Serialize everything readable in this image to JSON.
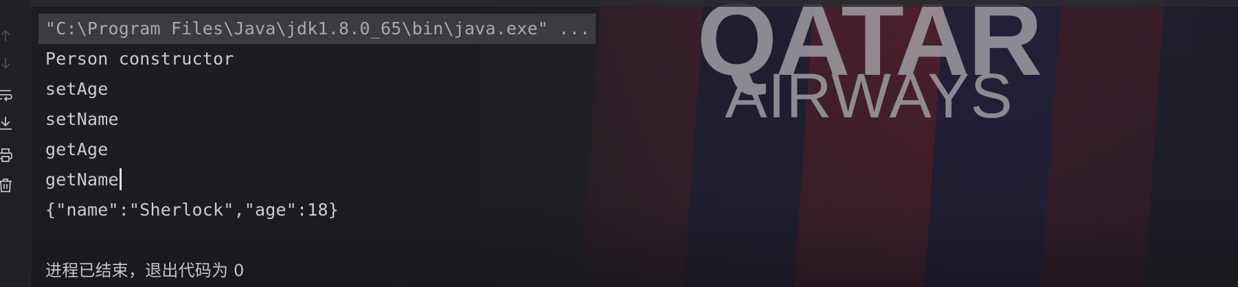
{
  "toolbar": {
    "buttons": [
      {
        "icon": "arrow-up-icon"
      },
      {
        "icon": "arrow-down-icon"
      },
      {
        "icon": "soft-wrap-icon"
      },
      {
        "icon": "scroll-to-end-icon"
      },
      {
        "icon": "print-icon"
      },
      {
        "icon": "trash-icon"
      }
    ]
  },
  "console": {
    "command": "\"C:\\Program Files\\Java\\jdk1.8.0_65\\bin\\java.exe\" ...",
    "lines": [
      "Person constructor",
      "setAge",
      "setName",
      "getAge",
      "getName",
      "{\"name\":\"Sherlock\",\"age\":18}"
    ],
    "exit_message": "进程已结束，退出代码为 0"
  },
  "background": {
    "logo_line1": "QATAR",
    "logo_line2": "AIRWAYS"
  },
  "colors": {
    "console_bg": "#1c1e22",
    "text": "#c9ccd1",
    "command_highlight": "#3a3c41"
  }
}
